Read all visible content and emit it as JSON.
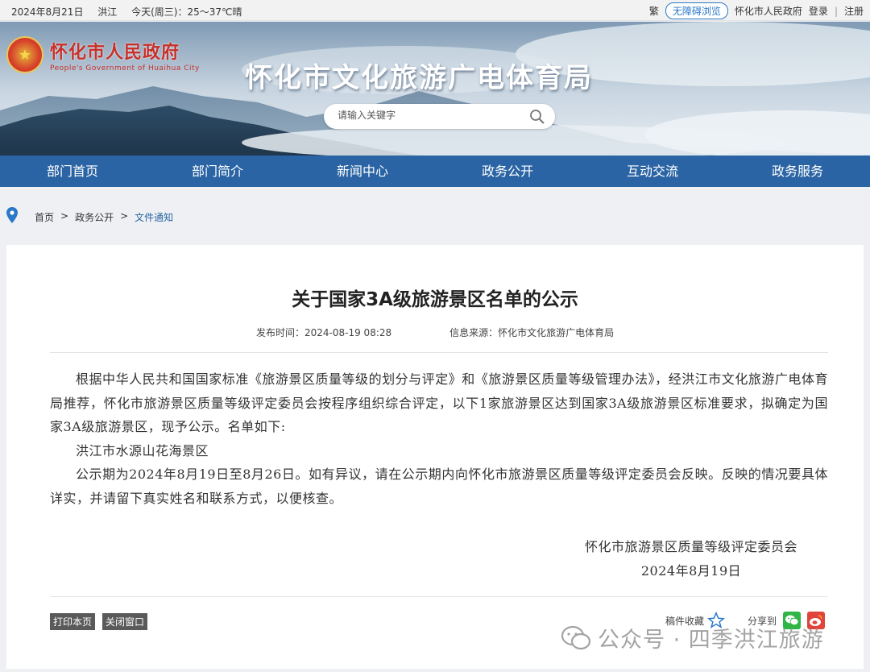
{
  "topbar": {
    "date": "2024年8月21日",
    "city": "洪江",
    "weather": "今天(周三)：25～37℃晴",
    "traditional": "繁",
    "accessible": "无障碍浏览",
    "gov_link": "怀化市人民政府",
    "login": "登录",
    "separator": "|",
    "register": "注册"
  },
  "banner": {
    "logo_cn": "怀化市人民政府",
    "logo_en": "People's Government of Huaihua City",
    "dept_title": "怀化市文化旅游广电体育局",
    "search_placeholder": "请输入关键字"
  },
  "nav": {
    "items": [
      "部门首页",
      "部门简介",
      "新闻中心",
      "政务公开",
      "互动交流",
      "政务服务"
    ]
  },
  "breadcrumb": {
    "home": "首页",
    "sep": ">",
    "level1": "政务公开",
    "current": "文件通知"
  },
  "article": {
    "title": "关于国家3A级旅游景区名单的公示",
    "publish_time": "发布时间：2024-08-19 08:28",
    "source": "信息来源：怀化市文化旅游广电体育局",
    "paragraphs": [
      "根据中华人民共和国国家标准《旅游景区质量等级的划分与评定》和《旅游景区质量等级管理办法》，经洪江市文化旅游广电体育局推荐，怀化市旅游景区质量等级评定委员会按程序组织综合评定，以下1家旅游景区达到国家3A级旅游景区标准要求，拟确定为国家3A级旅游景区，现予公示。名单如下:",
      "洪江市水源山花海景区",
      "公示期为2024年8月19日至8月26日。如有异议，请在公示期内向怀化市旅游景区质量等级评定委员会反映。反映的情况要具体详实，并请留下真实姓名和联系方式，以便核查。"
    ],
    "signature_org": "怀化市旅游景区质量等级评定委员会",
    "signature_date": "2024年8月19日"
  },
  "actions": {
    "print": "打印本页",
    "close": "关闭窗口",
    "favorite": "稿件收藏",
    "share": "分享到"
  },
  "watermark": {
    "text": "公众号 · 四季洪江旅游"
  },
  "colors": {
    "nav_bg": "#2a64a4",
    "link_blue": "#2c78c8",
    "logo_red": "#c8302a"
  }
}
